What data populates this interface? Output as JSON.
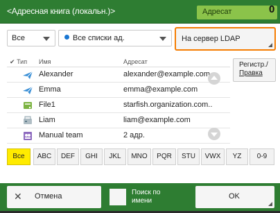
{
  "header": {
    "title": "<Адресная книга (локальн.)>",
    "destination_label": "Адресат",
    "destination_count": "0"
  },
  "filters": {
    "type_value": "Все",
    "list_value": "Все списки ад."
  },
  "ldap_button": "На сервер LDAP",
  "columns": {
    "type": "Тип",
    "name": "Имя",
    "address": "Адресат"
  },
  "entries": [
    {
      "icon": "email-icon",
      "name": "Alexander",
      "address": "alexander@example.com"
    },
    {
      "icon": "email-icon",
      "name": "Emma",
      "address": "emma@example.com"
    },
    {
      "icon": "file-server-icon",
      "name": "File1",
      "address": "starfish.organization.com.."
    },
    {
      "icon": "fax-icon",
      "name": "Liam",
      "address": "liam@example.com"
    },
    {
      "icon": "group-icon",
      "name": "Manual team",
      "address": "2 адр."
    }
  ],
  "register_button": {
    "line1": "Регистр./",
    "line2": "Правка"
  },
  "alphabet": [
    "Все",
    "ABC",
    "DEF",
    "GHI",
    "JKL",
    "MNO",
    "PQR",
    "STU",
    "VWX",
    "YZ",
    "0-9"
  ],
  "alphabet_active": "Все",
  "footer": {
    "cancel": "Отмена",
    "name_search_line1": "Поиск по",
    "name_search_line2": "имени",
    "ok": "OK"
  },
  "colors": {
    "accent_green": "#2e7d32",
    "highlight_orange": "#f57c00",
    "active_yellow": "#ffeb00"
  }
}
